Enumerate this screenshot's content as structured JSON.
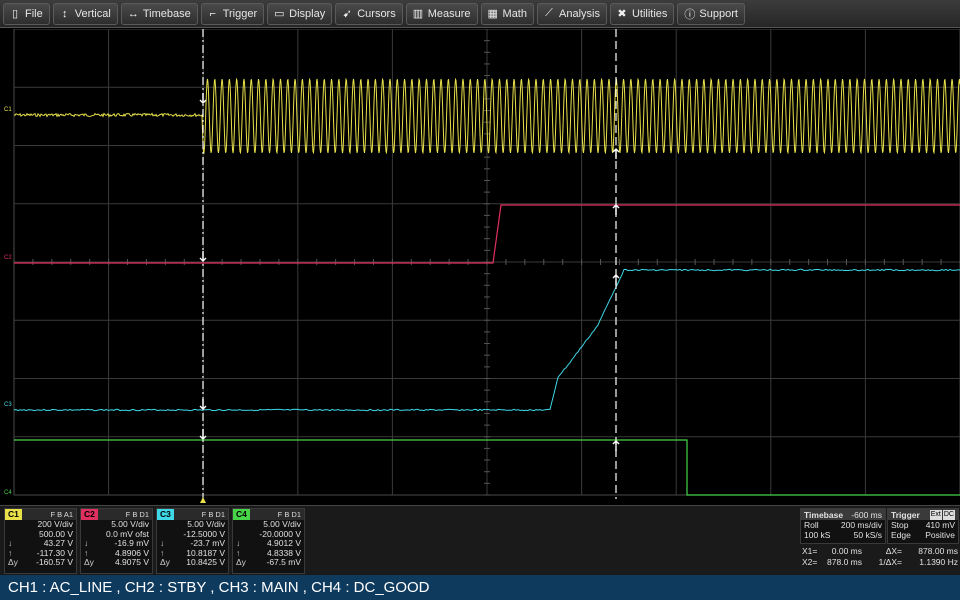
{
  "menu": [
    {
      "label": "File",
      "icon": "document-icon",
      "glyph": "▯"
    },
    {
      "label": "Vertical",
      "icon": "vertical-arrows-icon",
      "glyph": "↕"
    },
    {
      "label": "Timebase",
      "icon": "horizontal-arrows-icon",
      "glyph": "↔"
    },
    {
      "label": "Trigger",
      "icon": "trigger-icon",
      "glyph": "⌐"
    },
    {
      "label": "Display",
      "icon": "display-icon",
      "glyph": "▭"
    },
    {
      "label": "Cursors",
      "icon": "cursor-icon",
      "glyph": "➹"
    },
    {
      "label": "Measure",
      "icon": "measure-icon",
      "glyph": "▥"
    },
    {
      "label": "Math",
      "icon": "math-icon",
      "glyph": "▦"
    },
    {
      "label": "Analysis",
      "icon": "analysis-icon",
      "glyph": "⟋"
    },
    {
      "label": "Utilities",
      "icon": "tools-icon",
      "glyph": "✖"
    },
    {
      "label": "Support",
      "icon": "info-icon",
      "glyph": "ⓘ"
    }
  ],
  "channel_tags": {
    "c1": "C1",
    "c2": "C2",
    "c3": "C3",
    "c4": "C4"
  },
  "colors": {
    "c1": "#e8e14a",
    "c2": "#e0305f",
    "c3": "#3fd8e6",
    "c4": "#47d447",
    "grid": "#3a3a3a",
    "cursor": "#ffffff",
    "footer": "#0e3a5e"
  },
  "channels": [
    {
      "label": "C1",
      "flags": "F B A1",
      "color": "#e8e14a",
      "rows": [
        [
          "",
          "200 V/div"
        ],
        [
          "",
          "500.00 V"
        ],
        [
          "↓",
          "43.27 V"
        ],
        [
          "↑",
          "-117.30 V"
        ],
        [
          "Δy",
          "-160.57 V"
        ]
      ]
    },
    {
      "label": "C2",
      "flags": "F B D1",
      "color": "#e0305f",
      "rows": [
        [
          "",
          "5.00 V/div"
        ],
        [
          "",
          "0.0 mV ofst"
        ],
        [
          "↓",
          "-16.9 mV"
        ],
        [
          "↑",
          "4.8906 V"
        ],
        [
          "Δy",
          "4.9075 V"
        ]
      ]
    },
    {
      "label": "C3",
      "flags": "F B D1",
      "color": "#3fd8e6",
      "rows": [
        [
          "",
          "5.00 V/div"
        ],
        [
          "",
          "-12.5000 V"
        ],
        [
          "↓",
          "-23.7 mV"
        ],
        [
          "↑",
          "10.8187 V"
        ],
        [
          "Δy",
          "10.8425 V"
        ]
      ]
    },
    {
      "label": "C4",
      "flags": "F B D1",
      "color": "#47d447",
      "rows": [
        [
          "",
          "5.00 V/div"
        ],
        [
          "",
          "-20.0000 V"
        ],
        [
          "↓",
          "4.9012 V"
        ],
        [
          "↑",
          "4.8338 V"
        ],
        [
          "Δy",
          "-67.5 mV"
        ]
      ]
    }
  ],
  "timebase": {
    "title": "Timebase",
    "delay": "-600 ms",
    "mode": "Roll",
    "per_div": "200 ms/div",
    "samples": "100 kS",
    "rate": "50 kS/s"
  },
  "trigger": {
    "title": "Trigger",
    "badge_ext": "Ext",
    "badge_dc": "DC",
    "mode": "Stop",
    "level": "410 mV",
    "type": "Edge",
    "slope": "Positive"
  },
  "cursors": {
    "x1_label": "X1=",
    "x1": "0.00 ms",
    "dx_label": "ΔX=",
    "dx": "878.00 ms",
    "x2_label": "X2=",
    "x2": "878.0 ms",
    "inv_label": "1/ΔX=",
    "inv": "1.1390 Hz"
  },
  "footer": "CH1 : AC_LINE , CH2 : STBY , CH3 : MAIN , CH4 : DC_GOOD"
}
